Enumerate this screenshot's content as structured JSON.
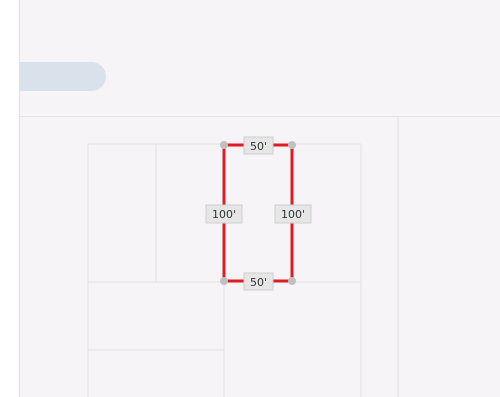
{
  "app": {
    "search": {
      "label": ""
    }
  },
  "plot": {
    "edge_color": "#e01b24",
    "handle_color": "#c0c0c0",
    "dimensions": {
      "top": "50'",
      "bottom": "50'",
      "left": "100'",
      "right": "100'"
    }
  }
}
